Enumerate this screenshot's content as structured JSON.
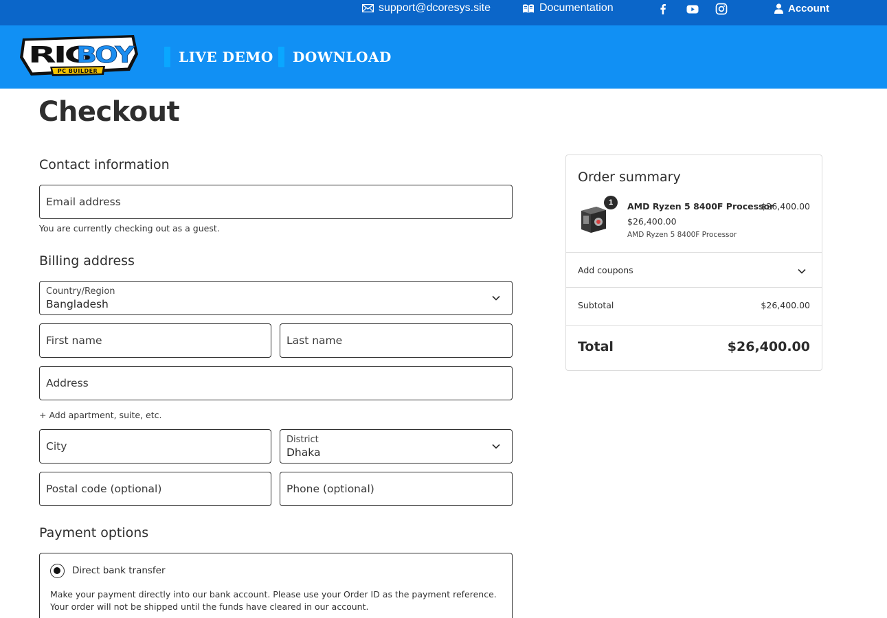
{
  "colors": {
    "topbar": "#0b66c9",
    "navbar": "#1190f4",
    "nav_accent": "#0aa7ff"
  },
  "topbar": {
    "email": "support@dcoresys.site",
    "email_icon": "envelope-icon",
    "docs": "Documentation",
    "docs_icon": "book-icon",
    "social": [
      "facebook-icon",
      "youtube-icon",
      "instagram-icon"
    ],
    "account": "Account",
    "account_icon": "user-icon"
  },
  "logo": {
    "line1": "RIGBOY",
    "line2": "PC BUILDER"
  },
  "nav": {
    "live_demo": "LIVE DEMO",
    "download": "DOWNLOAD"
  },
  "page": {
    "title": "Checkout"
  },
  "contact": {
    "heading": "Contact information",
    "email_placeholder": "Email address",
    "guest_note": "You are currently checking out as a guest."
  },
  "billing": {
    "heading": "Billing address",
    "country_label": "Country/Region",
    "country_value": "Bangladesh",
    "first_name": "First name",
    "last_name": "Last name",
    "address": "Address",
    "add_apartment": "+ Add apartment, suite, etc.",
    "city": "City",
    "district_label": "District",
    "district_value": "Dhaka",
    "postal": "Postal code (optional)",
    "phone": "Phone (optional)"
  },
  "payment": {
    "heading": "Payment options",
    "option_label": "Direct bank transfer",
    "description": "Make your payment directly into our bank account. Please use your Order ID as the payment reference. Your order will not be shipped until the funds have cleared in our account."
  },
  "summary": {
    "heading": "Order summary",
    "item": {
      "quantity": "1",
      "name": "AMD Ryzen 5 8400F Processor",
      "line_total": "$26,400.00",
      "unit_price": "$26,400.00",
      "description": "AMD Ryzen 5 8400F Processor"
    },
    "coupons": "Add coupons",
    "subtotal_label": "Subtotal",
    "subtotal_value": "$26,400.00",
    "total_label": "Total",
    "total_value": "$26,400.00"
  }
}
